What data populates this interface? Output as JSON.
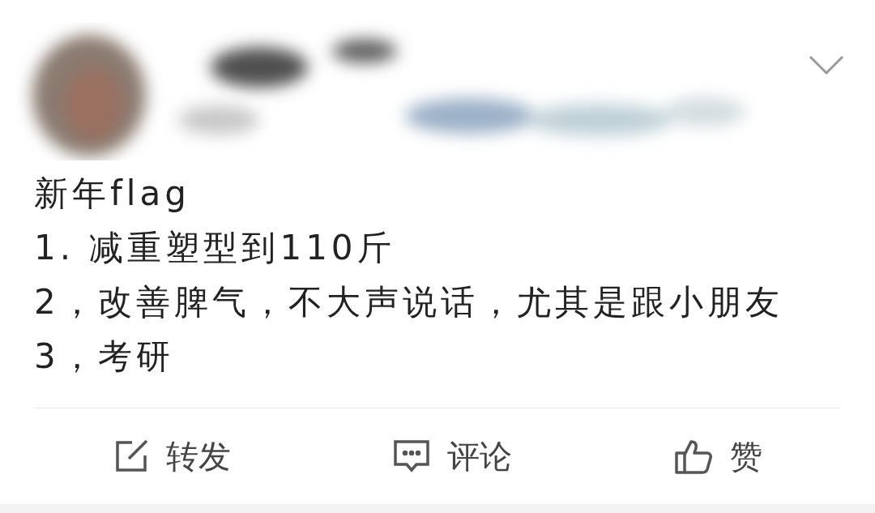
{
  "post": {
    "header": {
      "kind": "redacted"
    },
    "lines": [
      "新年flag",
      "1. 减重塑型到110斤",
      "2，改善脾气，不大声说话，尤其是跟小朋友",
      "3，考研"
    ]
  },
  "actions": [
    {
      "kind": "repost",
      "label": "转发"
    },
    {
      "kind": "comment",
      "label": "评论"
    },
    {
      "kind": "like",
      "label": "赞"
    }
  ]
}
